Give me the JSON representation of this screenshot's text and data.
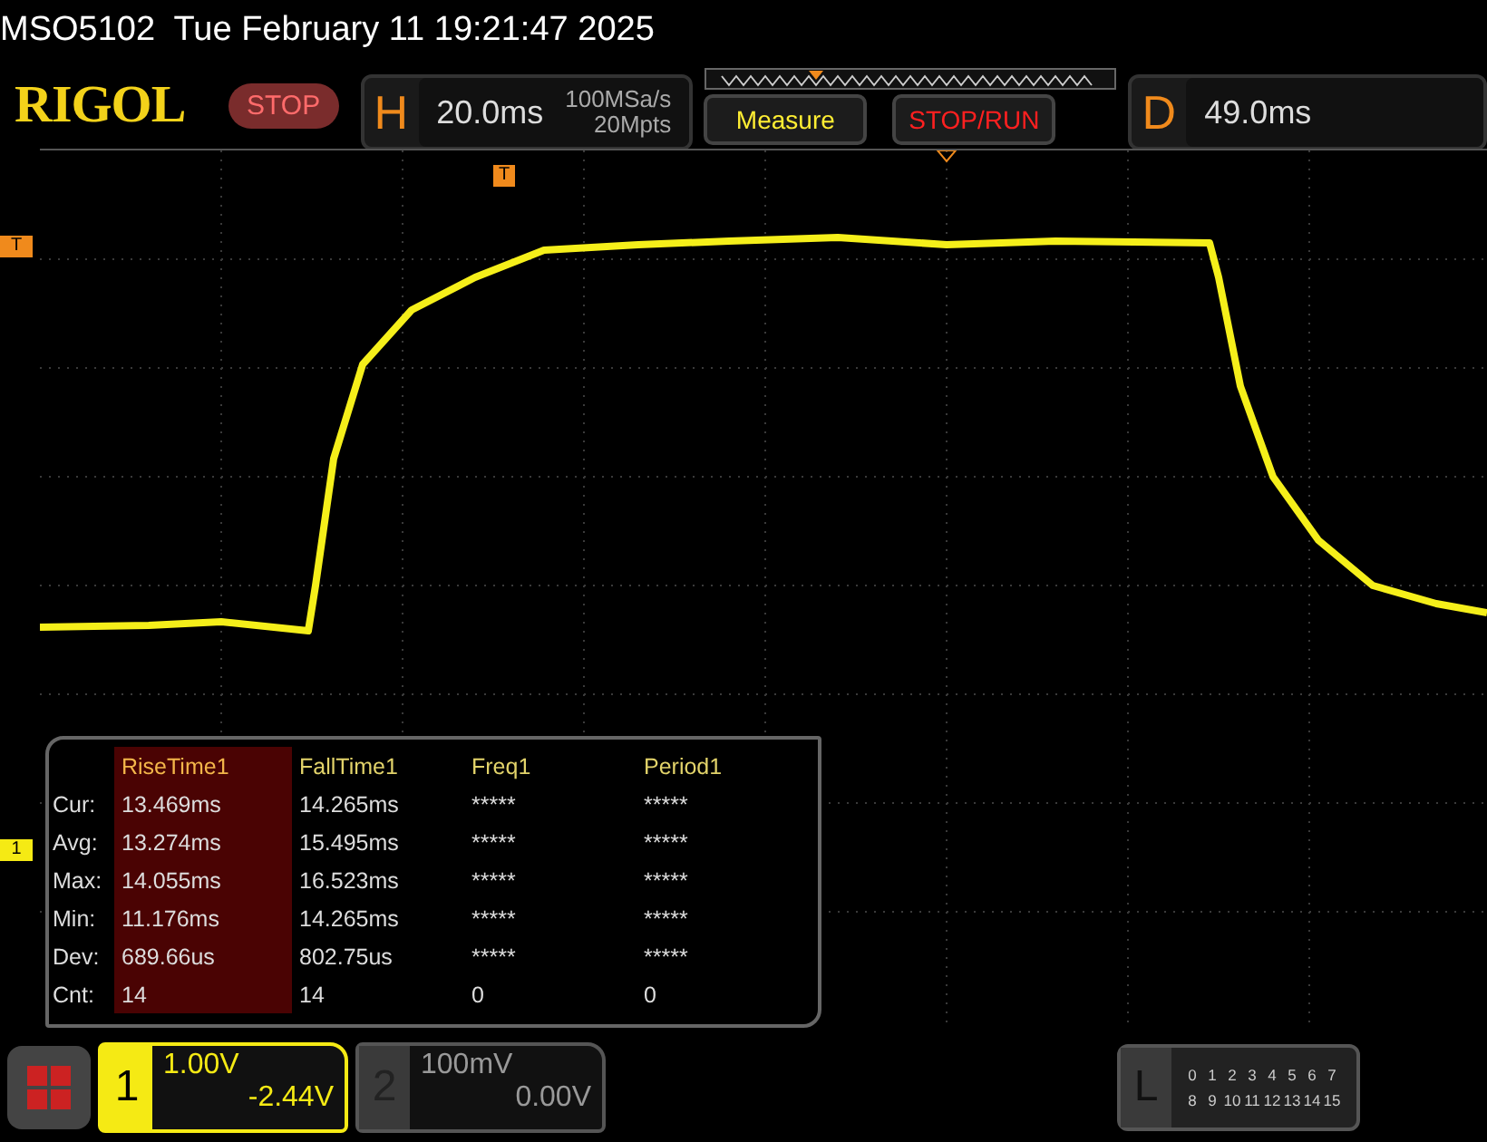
{
  "status_line": {
    "model": "MSO5102",
    "datetime": "Tue February 11 19:21:47 2025"
  },
  "toolbar": {
    "logo": "RIGOL",
    "run_state": "STOP",
    "horizontal": {
      "letter": "H",
      "timebase": "20.0ms",
      "sample_rate": "100MSa/s",
      "memory_depth": "20Mpts"
    },
    "buttons": [
      {
        "label": "Measure",
        "kind": "menu"
      },
      {
        "label": "STOP/RUN",
        "kind": "run"
      }
    ],
    "delay": {
      "letter": "D",
      "value": "49.0ms"
    }
  },
  "markers": {
    "trigger_position": "T",
    "trigger_level": "T",
    "channel": "1"
  },
  "measurements": {
    "columns": [
      {
        "label": "RiseTime1",
        "selected": true
      },
      {
        "label": "FallTime1",
        "selected": false
      },
      {
        "label": "Freq1",
        "selected": false
      },
      {
        "label": "Period1",
        "selected": false
      }
    ],
    "rows": [
      {
        "label": "Cur:",
        "values": [
          "13.469ms",
          "14.265ms",
          "*****",
          "*****"
        ]
      },
      {
        "label": "Avg:",
        "values": [
          "13.274ms",
          "15.495ms",
          "*****",
          "*****"
        ]
      },
      {
        "label": "Max:",
        "values": [
          "14.055ms",
          "16.523ms",
          "*****",
          "*****"
        ]
      },
      {
        "label": "Min:",
        "values": [
          "11.176ms",
          "14.265ms",
          "*****",
          "*****"
        ]
      },
      {
        "label": "Dev:",
        "values": [
          "689.66us",
          "802.75us",
          "*****",
          "*****"
        ]
      },
      {
        "label": "Cnt:",
        "values": [
          "14",
          "14",
          "0",
          "0"
        ]
      }
    ]
  },
  "channels": [
    {
      "number": "1",
      "active": true,
      "scale": "1.00V",
      "offset": "-2.44V"
    },
    {
      "number": "2",
      "active": false,
      "scale": "100mV",
      "offset": "0.00V"
    }
  ],
  "logic": {
    "letter": "L",
    "rows": [
      [
        "0",
        "1",
        "2",
        "3",
        "4",
        "5",
        "6",
        "7"
      ],
      [
        "8",
        "9",
        "10",
        "11",
        "12",
        "13",
        "14",
        "15"
      ]
    ]
  }
}
